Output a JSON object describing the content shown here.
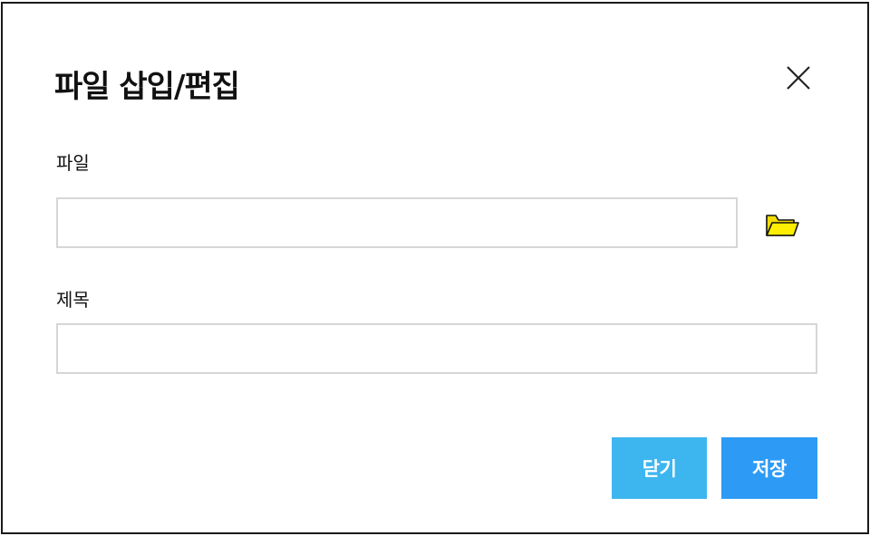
{
  "dialog": {
    "title": "파일 삽입/편집",
    "close_icon": "close-x-icon"
  },
  "fields": {
    "file": {
      "label": "파일",
      "value": "",
      "placeholder": "",
      "browse_icon": "folder-open-icon"
    },
    "title": {
      "label": "제목",
      "value": "",
      "placeholder": ""
    }
  },
  "buttons": {
    "close_label": "닫기",
    "save_label": "저장"
  },
  "colors": {
    "close_button": "#3db6f0",
    "save_button": "#2d9bf5",
    "folder_fill": "#ffee00",
    "input_border": "#d6d6d6"
  }
}
